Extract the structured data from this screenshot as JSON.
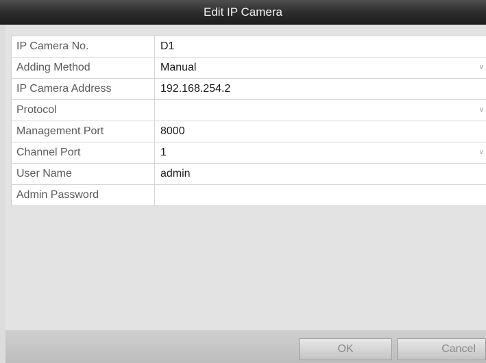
{
  "dialog": {
    "title": "Edit IP Camera"
  },
  "form": {
    "rows": [
      {
        "label": "IP Camera No.",
        "value": "D1",
        "dropdown": false
      },
      {
        "label": "Adding Method",
        "value": "Manual",
        "dropdown": true
      },
      {
        "label": "IP Camera Address",
        "value": "192.168.254.2",
        "dropdown": false
      },
      {
        "label": "Protocol",
        "value": "",
        "dropdown": true
      },
      {
        "label": "Management Port",
        "value": "8000",
        "dropdown": false
      },
      {
        "label": "Channel Port",
        "value": "1",
        "dropdown": true
      },
      {
        "label": "User Name",
        "value": "admin",
        "dropdown": false
      },
      {
        "label": "Admin Password",
        "value": "",
        "dropdown": false
      }
    ]
  },
  "buttons": {
    "ok_label": "OK",
    "cancel_label": "Cancel"
  },
  "colors": {
    "titlebar": "#2e2e2e",
    "panel": "#e3e3e3",
    "field_bg": "#ffffff"
  }
}
